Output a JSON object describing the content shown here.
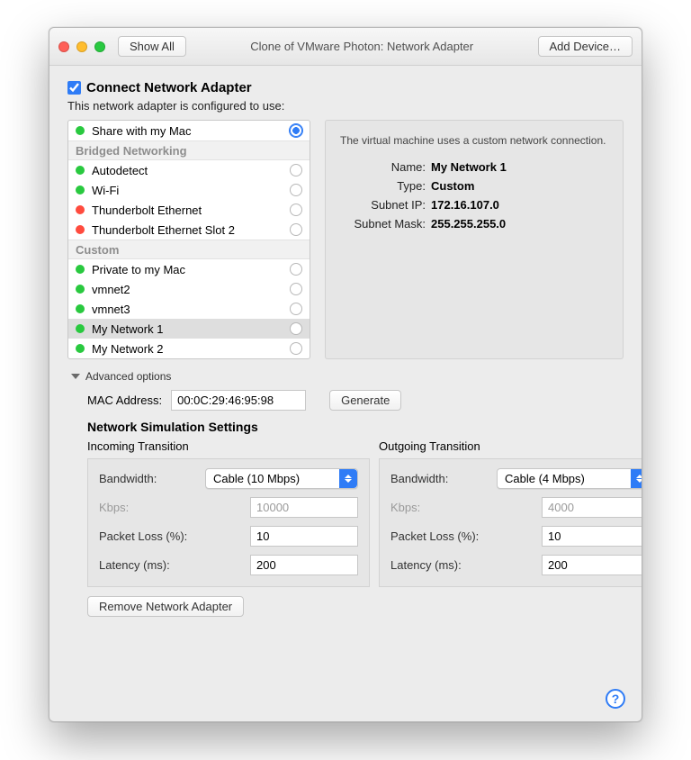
{
  "titlebar": {
    "show_all": "Show All",
    "title": "Clone of VMware Photon: Network Adapter",
    "add_device": "Add Device…"
  },
  "connect": {
    "checked": true,
    "label": "Connect Network Adapter",
    "subtext": "This network adapter is configured to use:"
  },
  "netlist": {
    "top": {
      "name": "Share with my Mac",
      "status": "green",
      "selected": true
    },
    "bridged_header": "Bridged Networking",
    "bridged": [
      {
        "name": "Autodetect",
        "status": "green"
      },
      {
        "name": "Wi-Fi",
        "status": "green"
      },
      {
        "name": "Thunderbolt Ethernet",
        "status": "red"
      },
      {
        "name": "Thunderbolt Ethernet Slot 2",
        "status": "red"
      }
    ],
    "custom_header": "Custom",
    "custom": [
      {
        "name": "Private to my Mac",
        "status": "green",
        "highlight": false
      },
      {
        "name": "vmnet2",
        "status": "green",
        "highlight": false
      },
      {
        "name": "vmnet3",
        "status": "green",
        "highlight": false
      },
      {
        "name": "My Network 1",
        "status": "green",
        "highlight": true
      },
      {
        "name": "My Network 2",
        "status": "green",
        "highlight": false
      }
    ]
  },
  "info": {
    "desc": "The virtual machine uses a custom network connection.",
    "name_label": "Name:",
    "name_value": "My Network 1",
    "type_label": "Type:",
    "type_value": "Custom",
    "subnet_label": "Subnet IP:",
    "subnet_value": "172.16.107.0",
    "mask_label": "Subnet Mask:",
    "mask_value": "255.255.255.0"
  },
  "advanced_label": "Advanced options",
  "mac": {
    "label": "MAC Address:",
    "value": "00:0C:29:46:95:98",
    "generate": "Generate"
  },
  "sim_header": "Network Simulation Settings",
  "incoming": {
    "title": "Incoming Transition",
    "bandwidth_label": "Bandwidth:",
    "bandwidth_value": "Cable (10 Mbps)",
    "kbps_label": "Kbps:",
    "kbps_value": "10000",
    "loss_label": "Packet Loss (%):",
    "loss_value": "10",
    "latency_label": "Latency (ms):",
    "latency_value": "200"
  },
  "outgoing": {
    "title": "Outgoing Transition",
    "bandwidth_label": "Bandwidth:",
    "bandwidth_value": "Cable (4 Mbps)",
    "kbps_label": "Kbps:",
    "kbps_value": "4000",
    "loss_label": "Packet Loss (%):",
    "loss_value": "10",
    "latency_label": "Latency (ms):",
    "latency_value": "200"
  },
  "remove_label": "Remove Network Adapter"
}
